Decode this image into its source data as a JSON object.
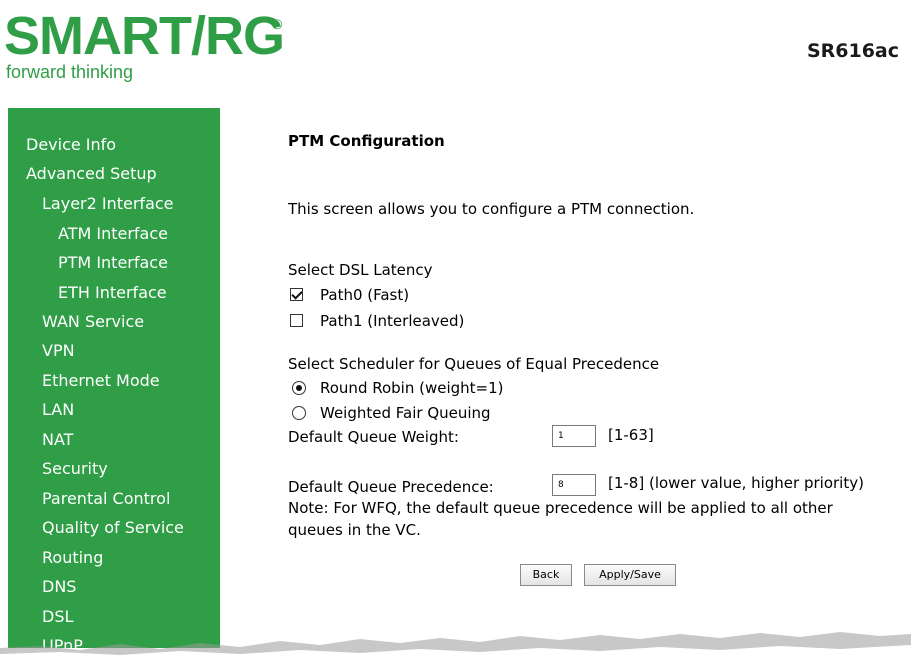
{
  "header": {
    "logo_text": "SMART/RG",
    "logo_reg": "®",
    "logo_tagline": "forward thinking",
    "model": "SR616ac"
  },
  "sidebar": {
    "items": [
      {
        "label": "Device Info"
      },
      {
        "label": "Advanced Setup"
      },
      {
        "label": "Layer2 Interface"
      },
      {
        "label": "ATM Interface"
      },
      {
        "label": "PTM Interface"
      },
      {
        "label": "ETH Interface"
      },
      {
        "label": "WAN Service"
      },
      {
        "label": "VPN"
      },
      {
        "label": "Ethernet Mode"
      },
      {
        "label": "LAN"
      },
      {
        "label": "NAT"
      },
      {
        "label": "Security"
      },
      {
        "label": "Parental Control"
      },
      {
        "label": "Quality of Service"
      },
      {
        "label": "Routing"
      },
      {
        "label": "DNS"
      },
      {
        "label": "DSL"
      },
      {
        "label": "UPnP"
      }
    ]
  },
  "main": {
    "title": "PTM Configuration",
    "description": "This screen allows you to configure a PTM connection.",
    "latency": {
      "label": "Select DSL Latency",
      "options": [
        {
          "label": "Path0 (Fast)",
          "checked": true
        },
        {
          "label": "Path1 (Interleaved)",
          "checked": false
        }
      ]
    },
    "scheduler": {
      "label": "Select Scheduler for Queues of Equal Precedence",
      "options": [
        {
          "label": "Round Robin (weight=1)",
          "selected": true
        },
        {
          "label": "Weighted Fair Queuing",
          "selected": false
        }
      ]
    },
    "weight": {
      "label": "Default Queue Weight:",
      "value": "1",
      "range": "[1-63]"
    },
    "precedence": {
      "label": "Default Queue Precedence:",
      "value": "8",
      "range": "[1-8] (lower value, higher priority)"
    },
    "note_line1": "Note: For WFQ, the default queue precedence will be applied to all other",
    "note_line2": "queues in the VC.",
    "buttons": {
      "back": "Back",
      "apply": "Apply/Save"
    }
  },
  "colors": {
    "brand_green": "#2f9e47",
    "sidebar_text": "#ffffff"
  }
}
